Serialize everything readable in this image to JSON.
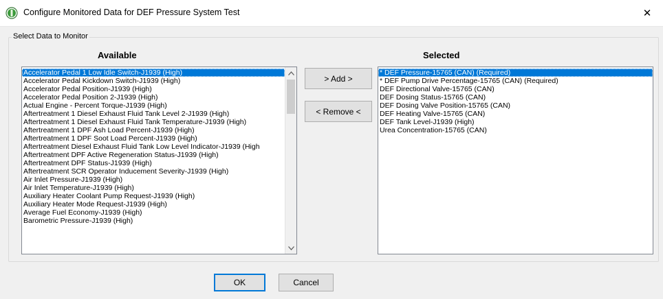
{
  "window": {
    "title": "Configure Monitored Data for DEF Pressure System Test",
    "close_glyph": "✕"
  },
  "group": {
    "label": "Select Data to Monitor"
  },
  "available": {
    "header": "Available",
    "selected_index": 0,
    "items": [
      "Accelerator Pedal 1 Low Idle Switch-J1939 (High)",
      "Accelerator Pedal Kickdown Switch-J1939 (High)",
      "Accelerator Pedal Position-J1939 (High)",
      "Accelerator Pedal Position 2-J1939 (High)",
      "Actual Engine - Percent Torque-J1939 (High)",
      "Aftertreatment 1 Diesel Exhaust Fluid Tank Level 2-J1939 (High)",
      "Aftertreatment 1 Diesel Exhaust Fluid Tank Temperature-J1939 (High)",
      "Aftertreatment 1 DPF Ash Load Percent-J1939 (High)",
      "Aftertreatment 1 DPF Soot Load Percent-J1939 (High)",
      "Aftertreatment Diesel Exhaust Fluid Tank Low Level Indicator-J1939 (High",
      "Aftertreatment DPF Active Regeneration Status-J1939 (High)",
      "Aftertreatment DPF Status-J1939 (High)",
      "Aftertreatment SCR Operator Inducement Severity-J1939 (High)",
      "Air Inlet Pressure-J1939 (High)",
      "Air Inlet Temperature-J1939 (High)",
      "Auxiliary Heater Coolant Pump Request-J1939 (High)",
      "Auxiliary Heater Mode Request-J1939 (High)",
      "Average Fuel Economy-J1939 (High)",
      "Barometric Pressure-J1939 (High)"
    ]
  },
  "selected": {
    "header": "Selected",
    "selected_index": 0,
    "items": [
      "* DEF Pressure-15765 (CAN) (Required)",
      "* DEF Pump Drive Percentage-15765 (CAN) (Required)",
      "DEF Directional Valve-15765 (CAN)",
      "DEF Dosing Status-15765 (CAN)",
      "DEF Dosing Valve Position-15765 (CAN)",
      "DEF Heating Valve-15765 (CAN)",
      "DEF Tank Level-J1939 (High)",
      "Urea Concentration-15765 (CAN)"
    ]
  },
  "buttons": {
    "add": "> Add >",
    "remove": "< Remove <",
    "ok": "OK",
    "cancel": "Cancel"
  },
  "colors": {
    "selection": "#0078d7",
    "window_bg": "#f0f0f0",
    "icon_green": "#3a9a3a"
  },
  "icons": {
    "app": "app-logo-icon",
    "close": "close-icon",
    "scroll_up": "chevron-up-icon",
    "scroll_down": "chevron-down-icon"
  }
}
